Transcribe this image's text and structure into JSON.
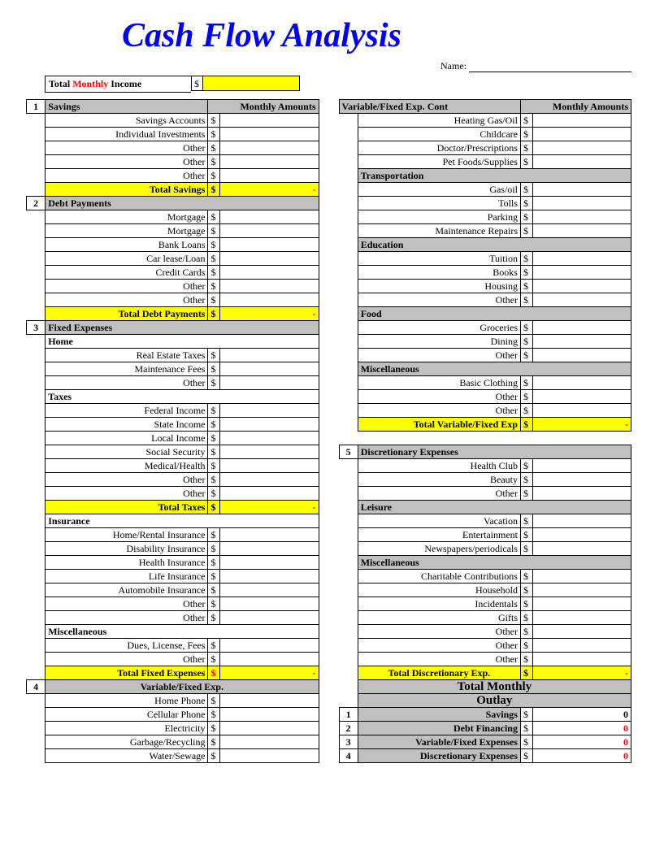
{
  "title": "Cash Flow Analysis",
  "name_label": "Name:",
  "income": {
    "label_pre": "Total ",
    "label_mid": "Monthly",
    "label_post": " Income",
    "dollar": "$",
    "value": ""
  },
  "left": {
    "header_amounts": "Monthly Amounts",
    "sections": [
      {
        "num": "1",
        "title": "Savings",
        "rows": [
          "Savings Accounts",
          "Individual Investments",
          "Other",
          "Other",
          "Other"
        ],
        "total_label": "Total Savings",
        "total_val": "-"
      },
      {
        "num": "2",
        "title": "Debt Payments",
        "rows": [
          "Mortgage",
          "Mortgage",
          "Bank Loans",
          "Car lease/Loan",
          "Credit Cards",
          "Other",
          "Other"
        ],
        "total_label": "Total Debt Payments",
        "total_val": "-"
      },
      {
        "num": "3",
        "title": "Fixed Expenses",
        "subsections": [
          {
            "sub": "Home",
            "rows": [
              "Real Estate Taxes",
              "Maintenance Fees",
              "Other"
            ]
          },
          {
            "sub": "Taxes",
            "rows": [
              "Federal Income",
              "State Income",
              "Local Income",
              "Social Security",
              "Medical/Health",
              "Other",
              "Other"
            ],
            "total_label": "Total Taxes",
            "total_val": "-"
          },
          {
            "sub": "Insurance",
            "rows": [
              "Home/Rental Insurance",
              "Disability Insurance",
              "Health Insurance",
              "Life Insurance",
              "Automobile Insurance",
              "Other",
              "Other"
            ]
          },
          {
            "sub": "Miscellaneous",
            "rows": [
              "Dues, License, Fees",
              "Other"
            ]
          }
        ],
        "total_label": "Total Fixed Expenses",
        "total_val": "-"
      },
      {
        "num": "4",
        "title": "Variable/Fixed Exp.",
        "rows": [
          "Home Phone",
          "Cellular Phone",
          "Electricity",
          "Garbage/Recycling",
          "Water/Sewage"
        ]
      }
    ]
  },
  "right": {
    "header_title": "Variable/Fixed Exp. Cont",
    "header_amounts": "Monthly Amounts",
    "cont_rows": [
      "Heating Gas/Oil",
      "Childcare",
      "Doctor/Prescriptions",
      "Pet Foods/Supplies"
    ],
    "subsections": [
      {
        "sub": "Transportation",
        "rows": [
          "Gas/oil",
          "Tolls",
          "Parking",
          "Maintenance Repairs"
        ]
      },
      {
        "sub": "Education",
        "rows": [
          "Tuition",
          "Books",
          "Housing",
          "Other"
        ]
      },
      {
        "sub": "Food",
        "rows": [
          "Groceries",
          "Dining",
          "Other"
        ]
      },
      {
        "sub": "Miscellaneous",
        "rows": [
          "Basic Clothing",
          "Other",
          "Other"
        ]
      }
    ],
    "total_label": "Total Variable/Fixed Exp",
    "total_val": "-",
    "sec5": {
      "num": "5",
      "title": "Discretionary Expenses",
      "rows": [
        "Health Club",
        "Beauty",
        "Other"
      ],
      "subsections": [
        {
          "sub": "Leisure",
          "rows": [
            "Vacation",
            "Entertainment",
            "Newspapers/periodicals"
          ]
        },
        {
          "sub": "Miscellaneous",
          "rows": [
            "Charitable Contributions",
            "Household",
            "Incidentals",
            "Gifts",
            "Other",
            "Other",
            "Other"
          ]
        }
      ],
      "total_label": "Total Discretionary Exp.",
      "total_val": "-"
    },
    "outlay": {
      "title1": "Total Monthly",
      "title2": "Outlay",
      "rows": [
        {
          "n": "1",
          "label": "Savings",
          "val": "0"
        },
        {
          "n": "2",
          "label": "Debt Financing",
          "val": "0"
        },
        {
          "n": "3",
          "label": "Variable/Fixed Expenses",
          "val": "0"
        },
        {
          "n": "4",
          "label": "Discretionary Expenses",
          "val": "0"
        }
      ]
    }
  },
  "dollar": "$"
}
